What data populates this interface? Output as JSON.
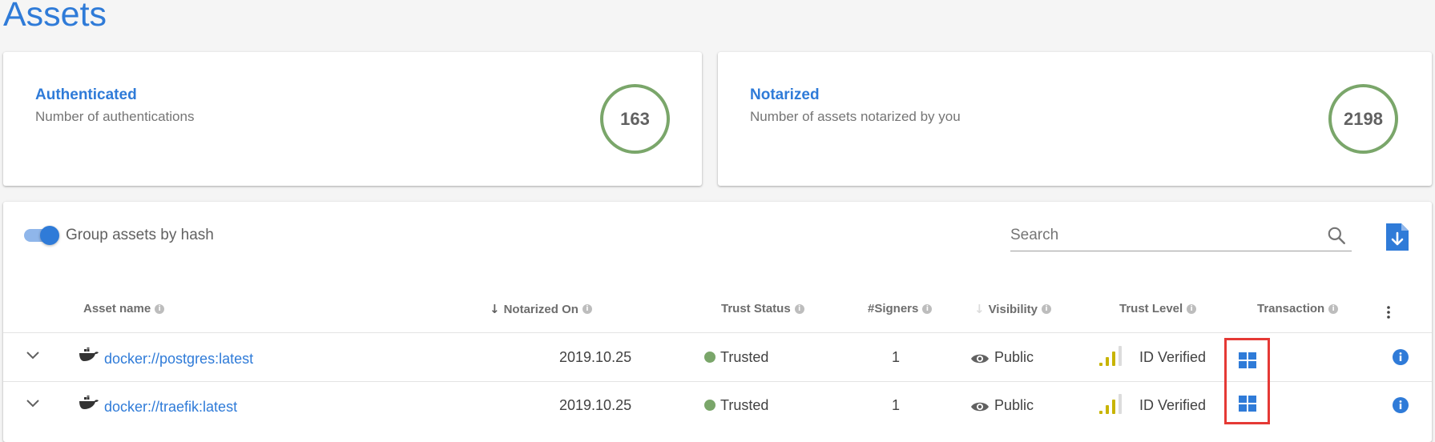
{
  "page": {
    "title": "Assets"
  },
  "stats": [
    {
      "title": "Authenticated",
      "subtitle": "Number of authentications",
      "value": "163"
    },
    {
      "title": "Notarized",
      "subtitle": "Number of assets notarized by you",
      "value": "2198"
    }
  ],
  "toolbar": {
    "group_label": "Group assets by hash",
    "group_enabled": true,
    "search_placeholder": "Search",
    "search_value": ""
  },
  "table": {
    "columns": [
      {
        "label": "Asset name",
        "info": "i"
      },
      {
        "label": "Notarized On",
        "sort": "↓",
        "info": "i"
      },
      {
        "label": "Trust Status",
        "info": "i"
      },
      {
        "label": "#Signers",
        "info": "i"
      },
      {
        "label": "Visibility",
        "sort": "↓",
        "info": "i"
      },
      {
        "label": "Trust Level",
        "info": "i"
      },
      {
        "label": "Transaction",
        "info": "i"
      }
    ],
    "rows": [
      {
        "asset": "docker://postgres:latest",
        "notarized_on": "2019.10.25",
        "trust_status": "Trusted",
        "signers": "1",
        "visibility": "Public",
        "trust_level": "ID Verified"
      },
      {
        "asset": "docker://traefik:latest",
        "notarized_on": "2019.10.25",
        "trust_status": "Trusted",
        "signers": "1",
        "visibility": "Public",
        "trust_level": "ID Verified"
      }
    ]
  },
  "colors": {
    "accent": "#2f7bd8",
    "ring": "#7aa66a",
    "trusted": "#7aa66a",
    "highlight": "#e53935",
    "trust_bar_active": "#c8b400"
  },
  "icons": {
    "search": "search-icon",
    "download": "download-file-icon",
    "expand": "chevron-down-icon",
    "asset": "docker-whale-icon",
    "visibility": "eye-icon",
    "trust_level": "signal-bars-icon",
    "transaction": "grid-icon",
    "details": "info-icon",
    "more": "kebab-menu-icon"
  }
}
